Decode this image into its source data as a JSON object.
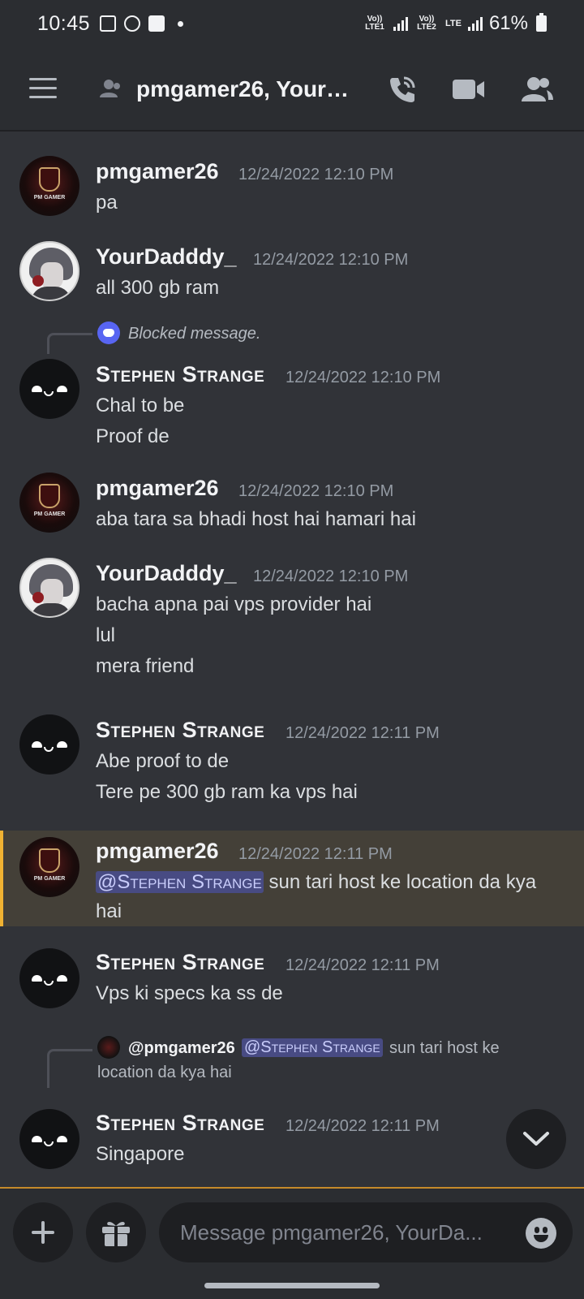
{
  "status": {
    "time": "10:45",
    "sim1": "Vo)) LTE1",
    "sim2": "Vo)) LTE2",
    "lte": "LTE",
    "battery": "61%"
  },
  "header": {
    "title": "pmgamer26, YourD..."
  },
  "messages": [
    {
      "author": "pmgamer26",
      "time": "12/24/2022 12:10 PM",
      "lines": [
        "pa"
      ]
    },
    {
      "author": "YourDadddy_",
      "time": "12/24/2022 12:10 PM",
      "lines": [
        "all 300 gb ram"
      ]
    },
    {
      "blocked": "Blocked message.",
      "author": "Stephen Strange",
      "time": "12/24/2022 12:10 PM",
      "lines": [
        "Chal to be",
        "Proof de"
      ]
    },
    {
      "author": "pmgamer26",
      "time": "12/24/2022 12:10 PM",
      "lines": [
        "aba tara sa bhadi host hai hamari hai"
      ]
    },
    {
      "author": "YourDadddy_",
      "time": "12/24/2022 12:10 PM",
      "lines": [
        "bacha apna pai vps provider hai",
        "lul",
        "mera friend"
      ]
    },
    {
      "author": "Stephen Strange",
      "time": "12/24/2022 12:11 PM",
      "lines": [
        "Abe proof to de",
        "Tere pe 300 gb ram ka vps hai"
      ]
    },
    {
      "author": "pmgamer26",
      "time": "12/24/2022 12:11 PM",
      "mention": "@Stephen Strange",
      "lines": [
        "sun tari host ke location da kya",
        "hai"
      ]
    },
    {
      "author": "Stephen Strange",
      "time": "12/24/2022 12:11 PM",
      "lines": [
        "Vps ki specs ka ss de"
      ]
    },
    {
      "reply": {
        "author": "@pmgamer26",
        "mention": "@Stephen Strange",
        "text1": "sun tari host ke",
        "text2": "location da kya hai"
      },
      "author": "Stephen Strange",
      "time": "12/24/2022 12:11 PM",
      "lines": [
        "Singapore"
      ]
    }
  ],
  "composer": {
    "placeholder": "Message pmgamer26, YourDa..."
  },
  "icons": [
    "menu-icon",
    "dm-group-icon",
    "call-icon",
    "video-icon",
    "members-icon",
    "chevron-down-icon",
    "plus-icon",
    "gift-icon",
    "emoji-icon"
  ],
  "colors": {
    "background": "#313338",
    "header": "#2b2d31",
    "mention": "#484b83",
    "highlight": "#444038",
    "accent_bar": "#f0b232"
  }
}
